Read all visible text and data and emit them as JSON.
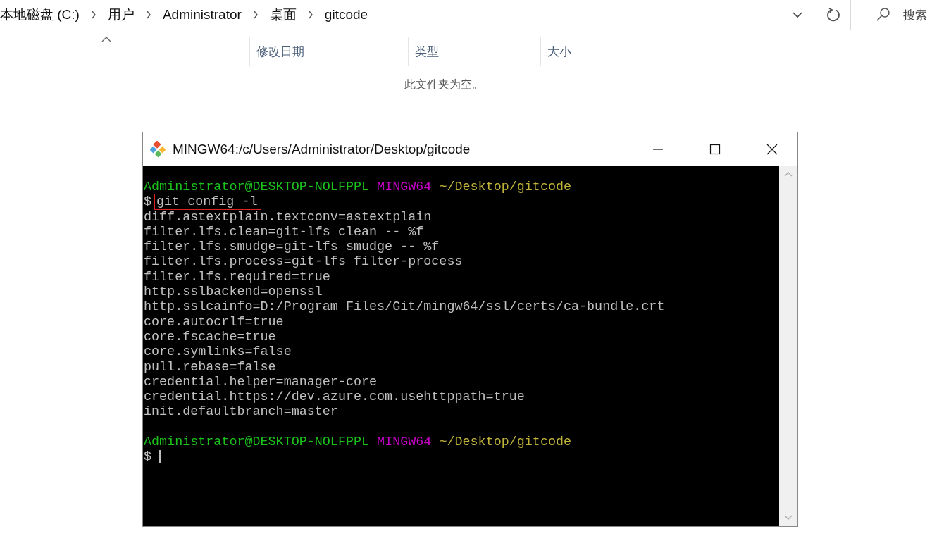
{
  "explorer": {
    "breadcrumb": [
      "本地磁盘 (C:)",
      "用户",
      "Administrator",
      "桌面",
      "gitcode"
    ],
    "search": {
      "placeholder": "搜索"
    },
    "columns": [
      {
        "sorted": true
      },
      {
        "label": "修改日期",
        "sorted": false
      },
      {
        "label": "类型",
        "sorted": false
      },
      {
        "label": "大小",
        "sorted": false
      }
    ],
    "empty_message": "此文件夹为空。"
  },
  "terminal": {
    "title": "MINGW64:/c/Users/Administrator/Desktop/gitcode",
    "lines": [
      {
        "kind": "prompt",
        "user": "Administrator@DESKTOP-NOLFPPL",
        "system": "MINGW64",
        "path": "~/Desktop/gitcode"
      },
      {
        "kind": "command",
        "symbol": "$",
        "text": "git config -l",
        "highlighted": true
      },
      {
        "kind": "output",
        "text": "diff.astextplain.textconv=astextplain"
      },
      {
        "kind": "output",
        "text": "filter.lfs.clean=git-lfs clean -- %f"
      },
      {
        "kind": "output",
        "text": "filter.lfs.smudge=git-lfs smudge -- %f"
      },
      {
        "kind": "output",
        "text": "filter.lfs.process=git-lfs filter-process"
      },
      {
        "kind": "output",
        "text": "filter.lfs.required=true"
      },
      {
        "kind": "output",
        "text": "http.sslbackend=openssl"
      },
      {
        "kind": "output",
        "text": "http.sslcainfo=D:/Program Files/Git/mingw64/ssl/certs/ca-bundle.crt"
      },
      {
        "kind": "output",
        "text": "core.autocrlf=true"
      },
      {
        "kind": "output",
        "text": "core.fscache=true"
      },
      {
        "kind": "output",
        "text": "core.symlinks=false"
      },
      {
        "kind": "output",
        "text": "pull.rebase=false"
      },
      {
        "kind": "output",
        "text": "credential.helper=manager-core"
      },
      {
        "kind": "output",
        "text": "credential.https://dev.azure.com.usehttppath=true"
      },
      {
        "kind": "output",
        "text": "init.defaultbranch=master"
      },
      {
        "kind": "blank"
      },
      {
        "kind": "prompt",
        "user": "Administrator@DESKTOP-NOLFPPL",
        "system": "MINGW64",
        "path": "~/Desktop/gitcode"
      },
      {
        "kind": "input",
        "symbol": "$",
        "cursor": true
      }
    ]
  }
}
